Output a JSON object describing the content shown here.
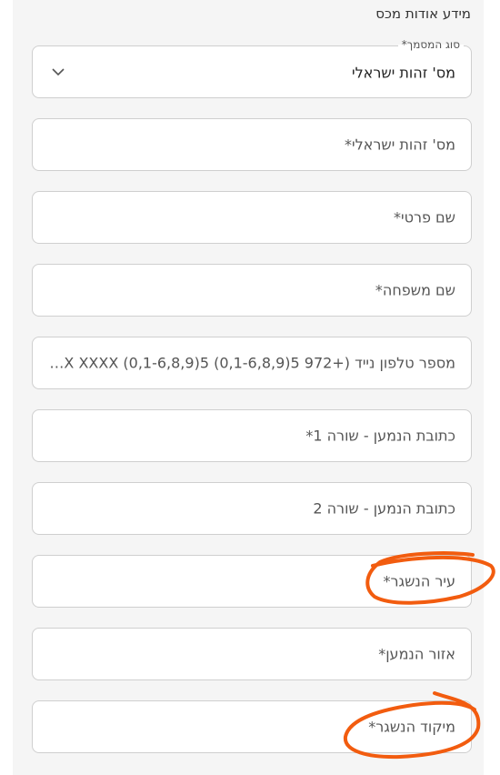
{
  "section": {
    "title": "מידע אודות מכס"
  },
  "document_type": {
    "label": "סוג המסמך*",
    "value": "מס' זהות ישראלי",
    "icon": "chevron-down-icon"
  },
  "fields": [
    {
      "name": "israeli-id-field",
      "placeholder": "מס' זהות ישראלי*"
    },
    {
      "name": "first-name-field",
      "placeholder": "שם פרטי*"
    },
    {
      "name": "last-name-field",
      "placeholder": "שם משפחה*"
    },
    {
      "name": "mobile-phone-field",
      "placeholder": "מספר טלפון נייד (+972 5(0,1-6,8,9) XXX XXXX (0,1-6,8,9)5..."
    },
    {
      "name": "address-line1-field",
      "placeholder": "כתובת הנמען - שורה 1*"
    },
    {
      "name": "address-line2-field",
      "placeholder": "כתובת הנמען - שורה 2"
    },
    {
      "name": "city-field",
      "placeholder": "עיר הנשגר*"
    },
    {
      "name": "region-field",
      "placeholder": "אזור הנמען*"
    },
    {
      "name": "postal-code-field",
      "placeholder": "מיקוד הנשגר*"
    }
  ],
  "colors": {
    "annotation": "#f25c0f",
    "panel": "#f5f5f5",
    "border": "#cfcfcf"
  }
}
